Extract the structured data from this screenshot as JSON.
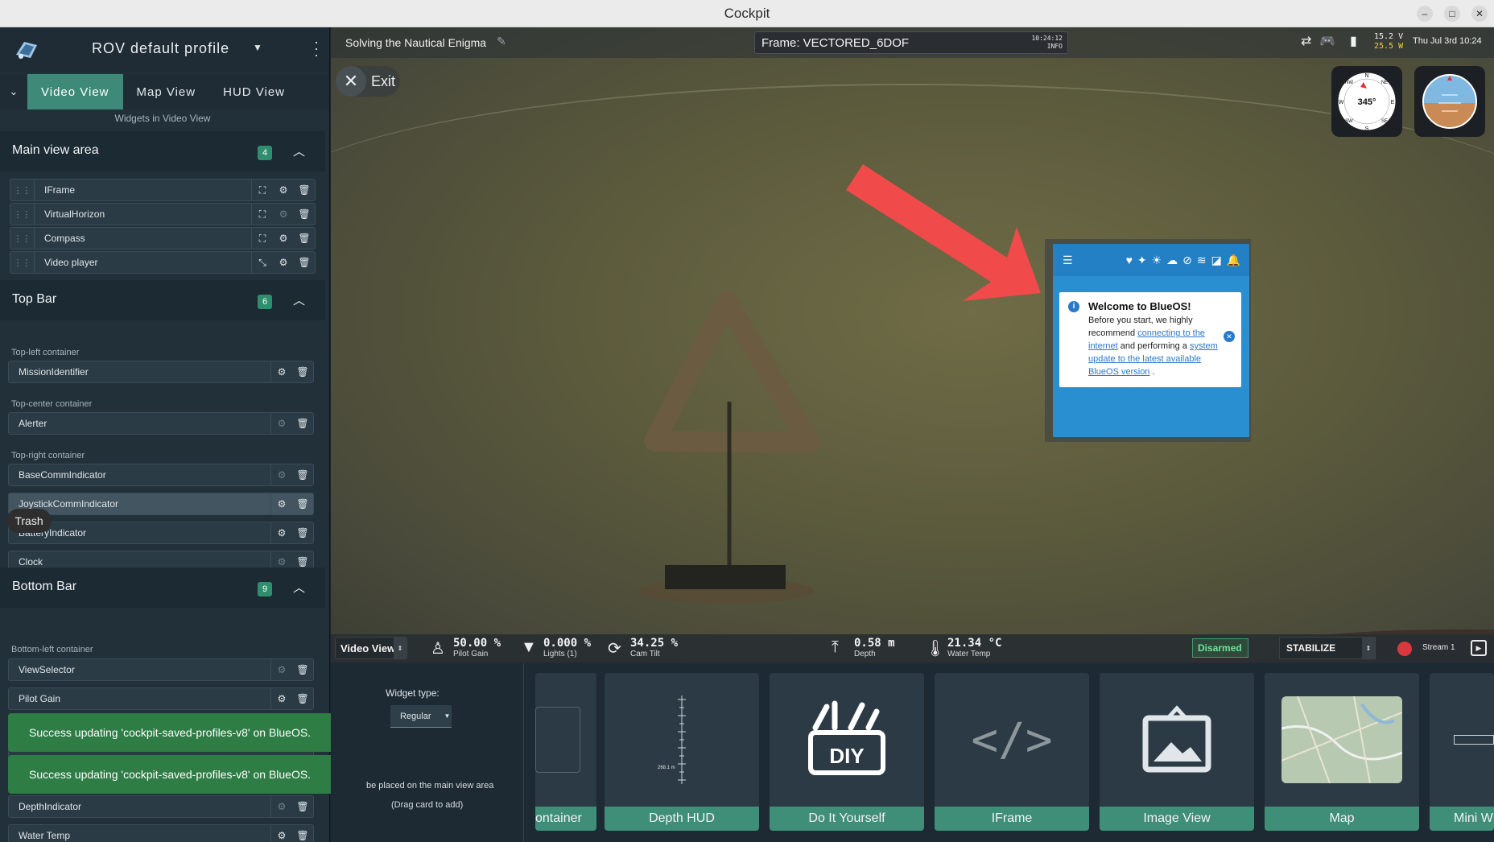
{
  "window": {
    "title": "Cockpit",
    "controls": [
      "–",
      "□",
      "✕"
    ]
  },
  "sidebar": {
    "profile": "ROV default profile",
    "tabs": [
      "Video View",
      "Map View",
      "HUD View"
    ],
    "subtitle": "Widgets in Video View",
    "main_view": {
      "title": "Main view area",
      "count": "4",
      "items": [
        "IFrame",
        "VirtualHorizon",
        "Compass",
        "Video player"
      ]
    },
    "top_bar": {
      "title": "Top Bar",
      "count": "6",
      "containers": [
        "Top-left container",
        "Top-center container",
        "Top-right container"
      ],
      "top_left": [
        "MissionIdentifier"
      ],
      "top_center": [
        "Alerter"
      ],
      "top_right": [
        "BaseCommIndicator",
        "JoystickCommIndicator",
        "BatteryIndicator",
        "Clock"
      ]
    },
    "bottom_bar": {
      "title": "Bottom Bar",
      "count": "9",
      "container": "Bottom-left container",
      "items": [
        "ViewSelector",
        "Pilot Gain",
        "DepthIndicator",
        "Water Temp"
      ]
    },
    "trash_label": "Trash",
    "toasts": [
      "Success updating 'cockpit-saved-profiles-v8' on BlueOS.",
      "Success updating 'cockpit-saved-profiles-v8' on BlueOS."
    ]
  },
  "topbar": {
    "mission": "Solving the Nautical Enigma",
    "alert": "Frame: VECTORED_6DOF",
    "alert_time": "10:24:12",
    "alert_level": "INFO",
    "voltage": "15.2 V",
    "power": "25.5 W",
    "clock": "Thu Jul 3rd 10:24"
  },
  "exit_label": "Exit",
  "compass": {
    "heading": "345°",
    "cardinals": [
      "N",
      "NE",
      "E",
      "SE",
      "S",
      "SW",
      "W",
      "NW"
    ]
  },
  "blueos": {
    "title": "Welcome to BlueOS!",
    "line1": "Before you start, we highly recommend",
    "link1": "connecting to the internet",
    "line2": "and performing a",
    "link2": "system update to the latest available BlueOS version",
    "end": "."
  },
  "bottombar": {
    "view": "Video View",
    "pilot_gain": {
      "value": "50.00 %",
      "label": "Pilot Gain"
    },
    "lights": {
      "value": "0.000 %",
      "label": "Lights (1)"
    },
    "cam_tilt": {
      "value": "34.25 %",
      "label": "Cam Tilt"
    },
    "depth": {
      "value": "0.58 m",
      "label": "Depth"
    },
    "water_temp": {
      "value": "21.34 °C",
      "label": "Water Temp"
    },
    "armed": "Disarmed",
    "mode": "STABILIZE",
    "stream": "Stream 1"
  },
  "drawer": {
    "widget_type_label": "Widget type:",
    "widget_type": "Regular",
    "hint1": "be placed on the main view area",
    "hint2": "(Drag card to add)",
    "cards": [
      "ontainer",
      "Depth HUD",
      "Do It Yourself",
      "IFrame",
      "Image View",
      "Map",
      "Mini W"
    ],
    "depth_readout": "268.1 m"
  }
}
